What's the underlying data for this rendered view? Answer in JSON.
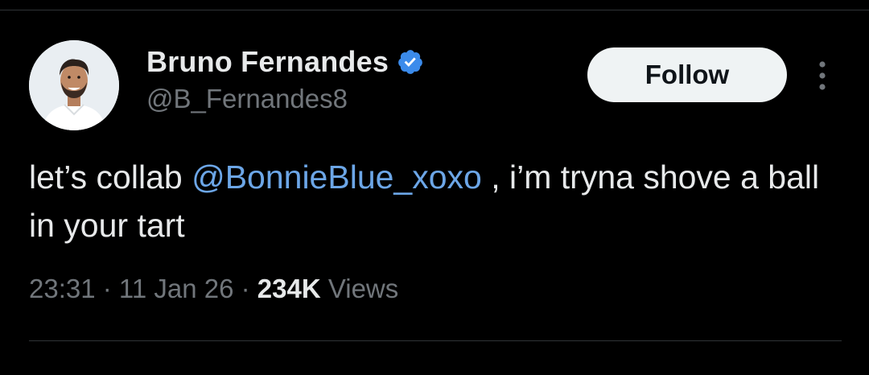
{
  "author": {
    "display_name": "Bruno Fernandes",
    "handle": "@B_Fernandes8",
    "verified": true,
    "verified_color": "#3b8beb",
    "avatar_icon": "profile-photo"
  },
  "header": {
    "follow_label": "Follow",
    "more_icon": "more-vertical-icon"
  },
  "tweet": {
    "text_before_mention": "let’s collab ",
    "mention": "@BonnieBlue_xoxo",
    "text_after_mention": " , i’m tryna shove a ball in your tart",
    "mention_color": "#6ca6e7"
  },
  "meta": {
    "time": "23:31",
    "separator": " · ",
    "date": "11 Jan 26",
    "views_count": "234K",
    "views_label": "Views"
  }
}
